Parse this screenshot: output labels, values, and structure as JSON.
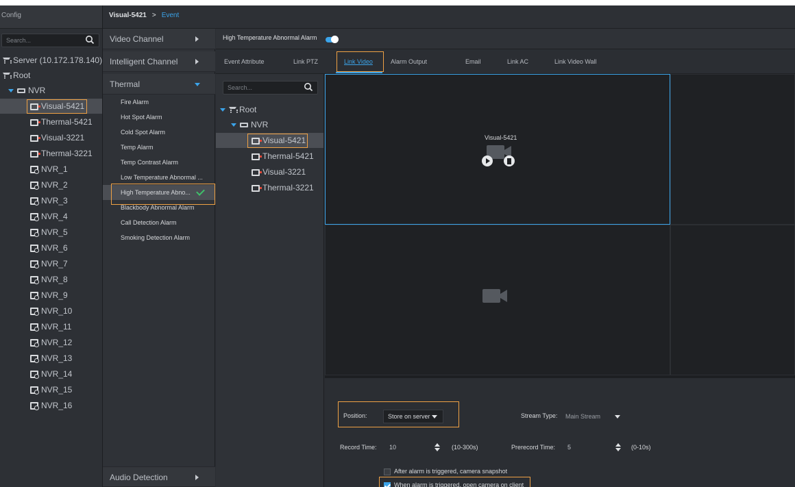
{
  "colors": {
    "accent": "#3ba4ea",
    "highlight": "#f0a245",
    "check": "#3fc06a",
    "alarm_dot": "#e24b3b"
  },
  "left_panel": {
    "title": "Config",
    "search_placeholder": "Search...",
    "server": "Server (10.172.178.140)",
    "root": "Root",
    "nvr": "NVR",
    "cameras": [
      "Visual-5421",
      "Thermal-5421",
      "Visual-3221",
      "Thermal-3221"
    ],
    "nvr_children": [
      "NVR_1",
      "NVR_2",
      "NVR_3",
      "NVR_4",
      "NVR_5",
      "NVR_6",
      "NVR_7",
      "NVR_8",
      "NVR_9",
      "NVR_10",
      "NVR_11",
      "NVR_12",
      "NVR_13",
      "NVR_14",
      "NVR_15",
      "NVR_16"
    ]
  },
  "breadcrumb": {
    "device": "Visual-5421",
    "separator": ">",
    "page": "Event"
  },
  "event_types": {
    "groups": {
      "video": "Video Channel",
      "intelligent": "Intelligent Channel",
      "thermal": "Thermal",
      "audio": "Audio Detection"
    },
    "thermal_items": [
      "Fire Alarm",
      "Hot Spot Alarm",
      "Cold Spot Alarm",
      "Temp Alarm",
      "Temp Contrast Alarm",
      "Low Temperature Abnormal ...",
      "High Temperature Abno...",
      "Blackbody Abnormal Alarm",
      "Call Detection Alarm",
      "Smoking Detection Alarm"
    ],
    "selected_index": 6
  },
  "alarm": {
    "title": "High Temperature Abnormal Alarm",
    "enabled": true
  },
  "tabs": [
    "Event Attribute",
    "Link PTZ",
    "Link Video",
    "Alarm Output",
    "Email",
    "Link AC",
    "Link Video Wall"
  ],
  "active_tab": "Link Video",
  "link_tree": {
    "search_placeholder": "Search...",
    "root": "Root",
    "nvr": "NVR",
    "cameras": [
      "Visual-5421",
      "Thermal-5421",
      "Visual-3221",
      "Thermal-3221"
    ]
  },
  "video_grid": {
    "cell1_label": "Visual-5421"
  },
  "settings": {
    "position_label": "Position:",
    "position_value": "Store on server",
    "stream_type_label": "Stream Type:",
    "stream_type_value": "Main Stream",
    "record_time_label": "Record Time:",
    "record_time_value": "10",
    "record_time_range": "(10-300s)",
    "prerecord_time_label": "Prerecord Time:",
    "prerecord_time_value": "5",
    "prerecord_time_range": "(0-10s)",
    "snapshot_label": "After alarm is triggered, camera snapshot",
    "snapshot_checked": false,
    "open_camera_label": "When alarm is triggered, open camera on client",
    "open_camera_checked": true
  }
}
